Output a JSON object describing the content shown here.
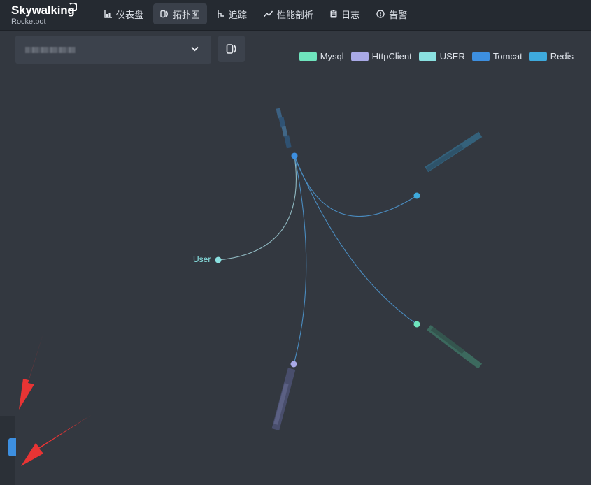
{
  "brand": {
    "name": "Skywalking",
    "subtitle": "Rocketbot"
  },
  "nav": [
    {
      "label": "仪表盘",
      "icon": "chart-icon"
    },
    {
      "label": "拓扑图",
      "icon": "topology-icon",
      "active": true
    },
    {
      "label": "追踪",
      "icon": "trace-icon"
    },
    {
      "label": "性能剖析",
      "icon": "profile-icon"
    },
    {
      "label": "日志",
      "icon": "log-icon"
    },
    {
      "label": "告警",
      "icon": "alarm-icon"
    }
  ],
  "toolbar": {
    "service_select": {
      "value": "(blurred)",
      "icon": "chevron-down-icon"
    },
    "view_button_icon": "topology-icon"
  },
  "legend": [
    {
      "label": "Mysql",
      "color": "#6fe4bd"
    },
    {
      "label": "HttpClient",
      "color": "#a9a9e6"
    },
    {
      "label": "USER",
      "color": "#8ae0e0"
    },
    {
      "label": "Tomcat",
      "color": "#3d8fe0"
    },
    {
      "label": "Redis",
      "color": "#3eaadd"
    }
  ],
  "topology": {
    "user_node_label": "User",
    "colors": {
      "link": "#4a8cc0",
      "user_link": "#8fb8c0"
    }
  }
}
